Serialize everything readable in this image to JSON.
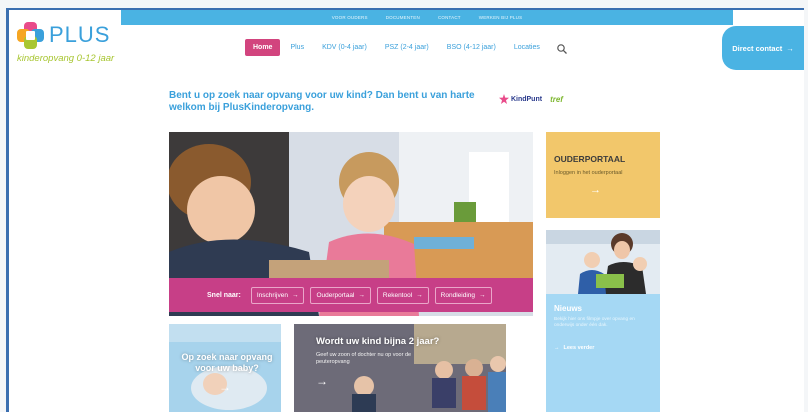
{
  "topbar": {
    "links": [
      "VOOR OUDERS",
      "DOCUMENTEN",
      "CONTACT",
      "WERKEN BIJ PLUS"
    ]
  },
  "logo": {
    "name": "PLUS",
    "tagline": "kinderopvang 0-12 jaar"
  },
  "nav": {
    "items": [
      "Home",
      "Plus",
      "KDV (0-4 jaar)",
      "PSZ (2-4 jaar)",
      "BSO (4-12 jaar)",
      "Locaties"
    ],
    "active_index": 0
  },
  "direct_contact": {
    "label": "Direct contact",
    "arrow": "→"
  },
  "intro": {
    "text": "Bent u op zoek naar opvang voor uw kind? Dan bent u van harte welkom bij PlusKinderopvang."
  },
  "partners": {
    "kindpunt": "KindPunt",
    "tref": "tref"
  },
  "hero": {
    "goto_label": "Snel naar:",
    "buttons": [
      "Inschrijven",
      "Ouderportaal",
      "Rekentool",
      "Rondleiding"
    ]
  },
  "portal": {
    "title": "OUDERPORTAAL",
    "subtitle": "Inloggen in het ouderportaal",
    "arrow": "→"
  },
  "news": {
    "title": "Nieuws",
    "text": "Bekijk hier ons filmpje over opvang en onderwijs onder één dak.",
    "more": "Lees verder",
    "arrow": "→"
  },
  "card_baby": {
    "title": "Op zoek naar opvang voor uw baby?",
    "arrow": "→"
  },
  "card_two": {
    "title": "Wordt uw kind bijna 2 jaar?",
    "subtitle": "Geef uw zoon of dochter nu op voor de peuteropvang",
    "arrow": "→"
  },
  "colors": {
    "brand_blue": "#3aa0db",
    "magenta": "#c73f87",
    "home_pink": "#d2447e",
    "portal_yellow": "#f2c76b",
    "news_blue": "#a5d8f4",
    "logo_green": "#a8c632"
  }
}
